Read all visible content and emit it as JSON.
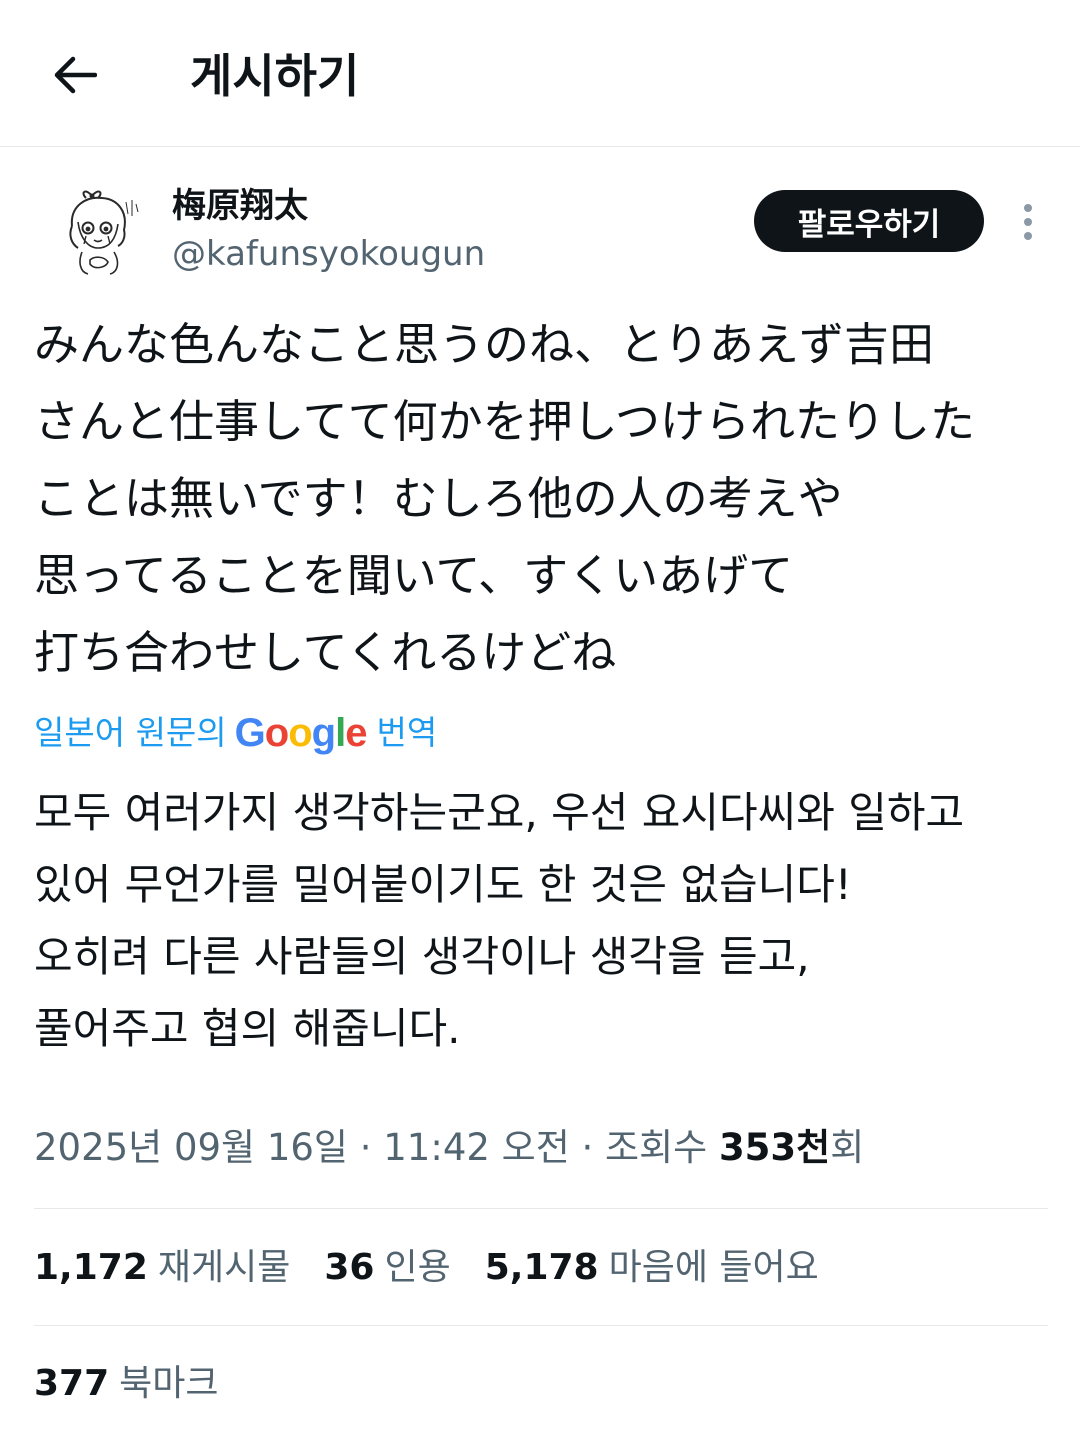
{
  "header": {
    "title": "게시하기",
    "back_icon": "arrow-left-icon"
  },
  "author": {
    "display_name": "梅原翔太",
    "handle": "@kafunsyokougun",
    "follow_label": "팔로우하기",
    "more_icon": "more-vertical-icon"
  },
  "tweet": {
    "lines": [
      "みんな色んなこと思うのね、とりあえず吉田",
      "さんと仕事してて何かを押しつけられたりした",
      "ことは無いです！むしろ他の人の考えや",
      "思ってることを聞いて、すくいあげて",
      "打ち合わせしてくれるけどね"
    ]
  },
  "translation": {
    "label_prefix": "일본어 원문의",
    "brand": "Google",
    "label_suffix": "번역",
    "lines": [
      "모두 여러가지 생각하는군요, 우선 요시다씨와 일하고",
      "있어 무언가를 밀어붙이기도 한 것은 없습니다!",
      "오히려 다른 사람들의 생각이나 생각을 듣고,",
      "풀어주고 협의 해줍니다."
    ]
  },
  "meta": {
    "date": "2025년 09월 16일",
    "separator": "·",
    "time": "11:42 오전",
    "views_label": "조회수",
    "views_count": "353천",
    "views_suffix": "회"
  },
  "stats": {
    "reposts": {
      "count": "1,172",
      "label": "재게시물"
    },
    "quotes": {
      "count": "36",
      "label": "인용"
    },
    "likes": {
      "count": "5,178",
      "label": "마음에 들어요"
    },
    "bookmarks": {
      "count": "377",
      "label": "북마크"
    }
  },
  "colors": {
    "text": "#0f1419",
    "secondary": "#536471",
    "link": "#1d9bf0",
    "divider": "#e6e9ec",
    "button_bg": "#0f1419"
  }
}
